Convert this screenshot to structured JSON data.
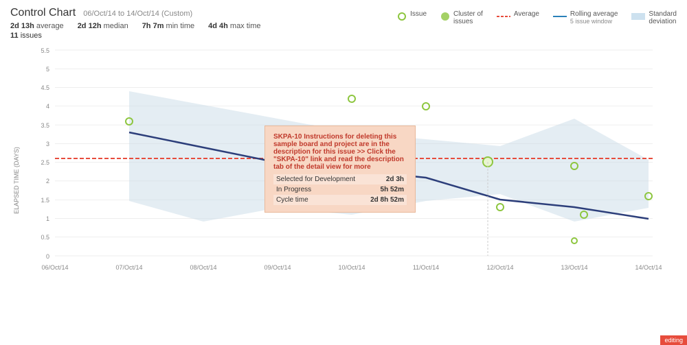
{
  "header": {
    "title": "Control Chart",
    "date_range": "06/Oct/14 to 14/Oct/14 (Custom)",
    "stats": [
      {
        "value": "2d 13h",
        "label": "average"
      },
      {
        "value": "2d 12h",
        "label": "median"
      },
      {
        "value": "7h 7m",
        "label": "min time"
      },
      {
        "value": "4d 4h",
        "label": "max time"
      }
    ],
    "issues_count": "11",
    "issues_label": "issues"
  },
  "legend": [
    {
      "name": "issue",
      "label": "Issue",
      "type": "circle-outline"
    },
    {
      "name": "cluster",
      "label": "Cluster of issues",
      "type": "circle-filled"
    },
    {
      "name": "average",
      "label": "Average",
      "type": "line-red"
    },
    {
      "name": "rolling",
      "label": "Rolling average",
      "sublabel": "5 issue window",
      "type": "line-blue"
    },
    {
      "name": "stddev",
      "label": "Standard deviation",
      "type": "rect-blue"
    }
  ],
  "tooltip": {
    "issue_id": "SKPA-10",
    "description": "Instructions for deleting this sample board and project are in the description for this issue >> Click the \"SKPA-10\" link and read the description tab of the detail view for more",
    "rows": [
      {
        "label": "Selected for Development",
        "value": "2d 3h"
      },
      {
        "label": "In Progress",
        "value": "5h 52m"
      },
      {
        "label": "Cycle time",
        "value": "2d 8h 52m"
      }
    ]
  },
  "chart": {
    "y_labels": [
      "5.5",
      "5",
      "4.5",
      "4",
      "3.5",
      "3",
      "2.5",
      "2",
      "1.5",
      "1",
      "0.5",
      "0"
    ],
    "x_labels": [
      "06/Oct/14",
      "07/Oct/14",
      "08/Oct/14",
      "09/Oct/14",
      "10/Oct/14",
      "11/Oct/14",
      "12/Oct/14",
      "13/Oct/14",
      "14/Oct/14"
    ],
    "y_axis_label": "ELAPSED TIME (DAYS)"
  }
}
